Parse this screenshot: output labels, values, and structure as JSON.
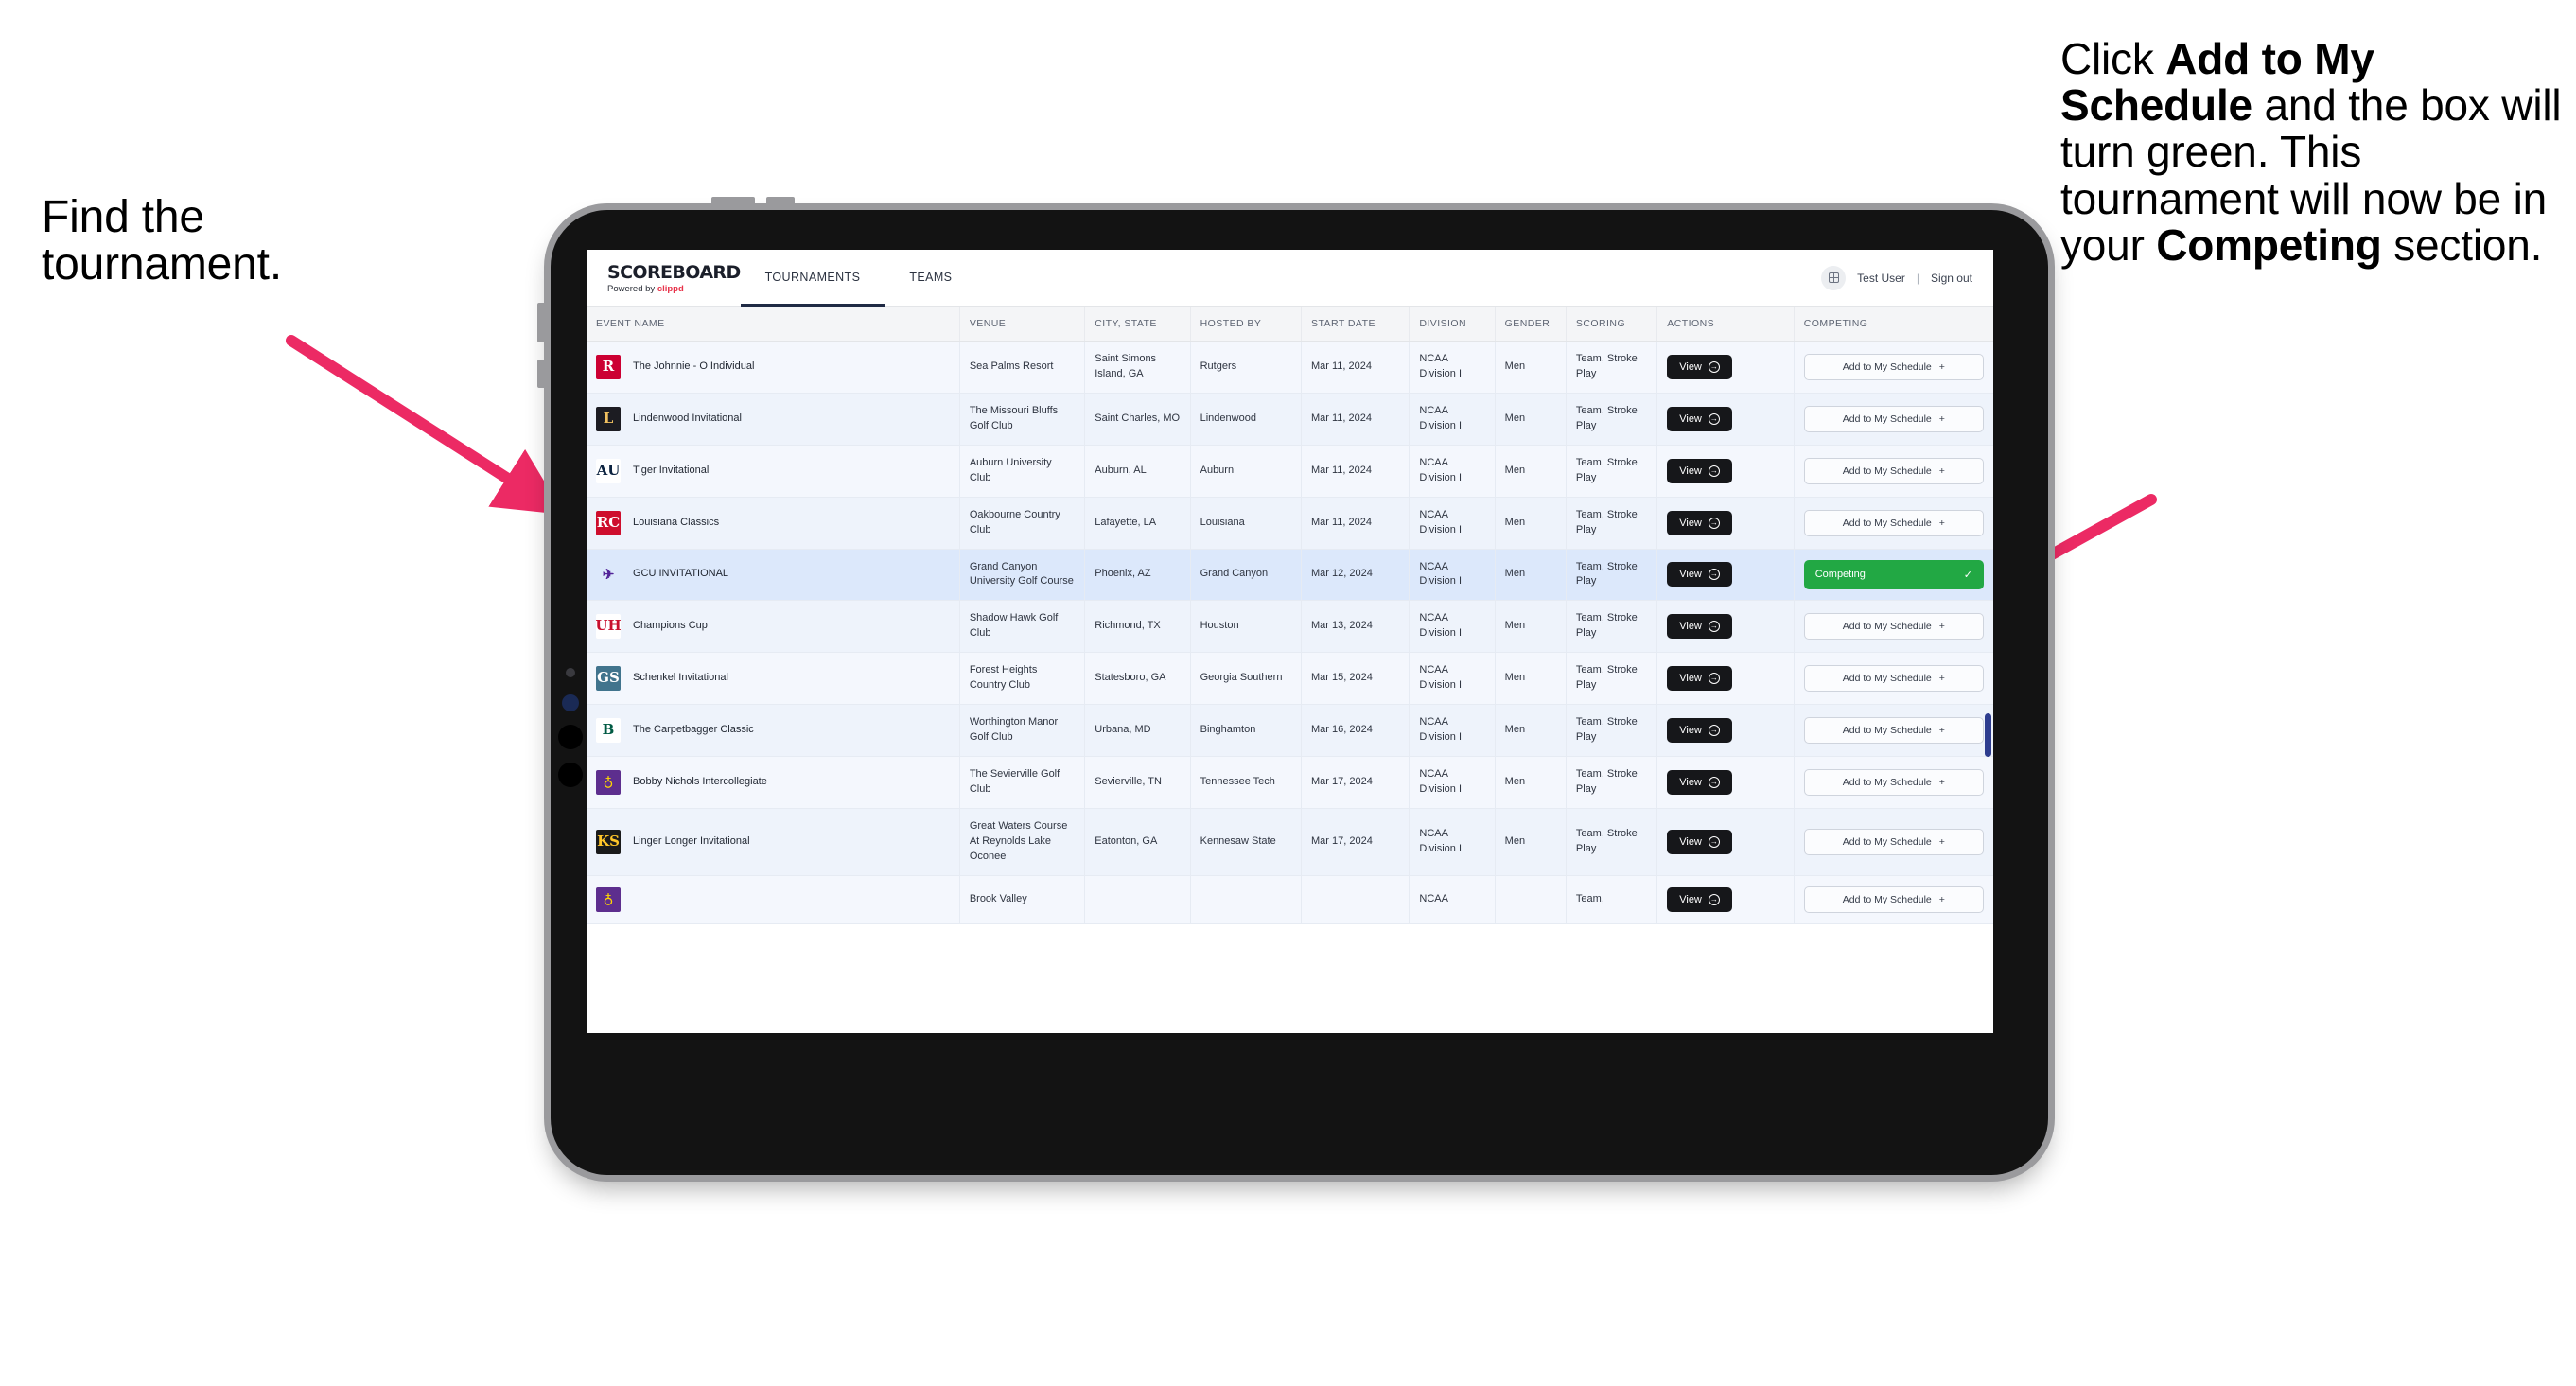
{
  "annotations": {
    "left": "Find the tournament.",
    "right_parts": [
      {
        "text": "Click ",
        "bold": false
      },
      {
        "text": "Add to My Schedule",
        "bold": true
      },
      {
        "text": " and the box will turn green. This tournament will now be in your ",
        "bold": false
      },
      {
        "text": "Competing",
        "bold": true
      },
      {
        "text": " section.",
        "bold": false
      }
    ],
    "arrow_color": "#ec2a64"
  },
  "app": {
    "brand_title": "SCOREBOARD",
    "brand_sub_prefix": "Powered by ",
    "brand_sub_name": "clippd",
    "tabs": [
      {
        "label": "TOURNAMENTS",
        "active": true
      },
      {
        "label": "TEAMS",
        "active": false
      }
    ],
    "header_right": {
      "app_icon": "grid-icon",
      "user": "Test User",
      "separator": "|",
      "signout": "Sign out"
    },
    "accent_green": "#22a844",
    "accent_pink": "#e8334a"
  },
  "table": {
    "columns": [
      "EVENT NAME",
      "VENUE",
      "CITY, STATE",
      "HOSTED BY",
      "START DATE",
      "DIVISION",
      "GENDER",
      "SCORING",
      "ACTIONS",
      "COMPETING"
    ],
    "view_label": "View",
    "add_label": "Add to My Schedule",
    "competing_label": "Competing",
    "rows": [
      {
        "event": "The Johnnie - O Individual",
        "logo": {
          "text": "R",
          "color": "#ffffff",
          "bg": "#cc0033"
        },
        "venue": "Sea Palms Resort",
        "city": "Saint Simons Island, GA",
        "hosted_by": "Rutgers",
        "start_date": "Mar 11, 2024",
        "division": "NCAA Division I",
        "gender": "Men",
        "scoring": "Team, Stroke Play",
        "competing": false
      },
      {
        "event": "Lindenwood Invitational",
        "logo": {
          "text": "L",
          "color": "#f0c060",
          "bg": "#1c1c22"
        },
        "venue": "The Missouri Bluffs Golf Club",
        "city": "Saint Charles, MO",
        "hosted_by": "Lindenwood",
        "start_date": "Mar 11, 2024",
        "division": "NCAA Division I",
        "gender": "Men",
        "scoring": "Team, Stroke Play",
        "competing": false
      },
      {
        "event": "Tiger Invitational",
        "logo": {
          "text": "AU",
          "color": "#0c2340",
          "bg": "#ffffff"
        },
        "venue": "Auburn University Club",
        "city": "Auburn, AL",
        "hosted_by": "Auburn",
        "start_date": "Mar 11, 2024",
        "division": "NCAA Division I",
        "gender": "Men",
        "scoring": "Team, Stroke Play",
        "competing": false
      },
      {
        "event": "Louisiana Classics",
        "logo": {
          "text": "RC",
          "color": "#ffffff",
          "bg": "#ce0e2d"
        },
        "venue": "Oakbourne Country Club",
        "city": "Lafayette, LA",
        "hosted_by": "Louisiana",
        "start_date": "Mar 11, 2024",
        "division": "NCAA Division I",
        "gender": "Men",
        "scoring": "Team, Stroke Play",
        "competing": false
      },
      {
        "event": "GCU INVITATIONAL",
        "logo": {
          "text": "✈",
          "color": "#522398",
          "bg": "transparent"
        },
        "venue": "Grand Canyon University Golf Course",
        "city": "Phoenix, AZ",
        "hosted_by": "Grand Canyon",
        "start_date": "Mar 12, 2024",
        "division": "NCAA Division I",
        "gender": "Men",
        "scoring": "Team, Stroke Play",
        "competing": true
      },
      {
        "event": "Champions Cup",
        "logo": {
          "text": "UH",
          "color": "#c8102e",
          "bg": "#ffffff"
        },
        "venue": "Shadow Hawk Golf Club",
        "city": "Richmond, TX",
        "hosted_by": "Houston",
        "start_date": "Mar 13, 2024",
        "division": "NCAA Division I",
        "gender": "Men",
        "scoring": "Team, Stroke Play",
        "competing": false
      },
      {
        "event": "Schenkel Invitational",
        "logo": {
          "text": "GS",
          "color": "#ffffff",
          "bg": "#41748d"
        },
        "venue": "Forest Heights Country Club",
        "city": "Statesboro, GA",
        "hosted_by": "Georgia Southern",
        "start_date": "Mar 15, 2024",
        "division": "NCAA Division I",
        "gender": "Men",
        "scoring": "Team, Stroke Play",
        "competing": false
      },
      {
        "event": "The Carpetbagger Classic",
        "logo": {
          "text": "B",
          "color": "#005a43",
          "bg": "#ffffff"
        },
        "venue": "Worthington Manor Golf Club",
        "city": "Urbana, MD",
        "hosted_by": "Binghamton",
        "start_date": "Mar 16, 2024",
        "division": "NCAA Division I",
        "gender": "Men",
        "scoring": "Team, Stroke Play",
        "competing": false
      },
      {
        "event": "Bobby Nichols Intercollegiate",
        "logo": {
          "text": "♁",
          "color": "#ffd700",
          "bg": "#5d2e8e"
        },
        "venue": "The Sevierville Golf Club",
        "city": "Sevierville, TN",
        "hosted_by": "Tennessee Tech",
        "start_date": "Mar 17, 2024",
        "division": "NCAA Division I",
        "gender": "Men",
        "scoring": "Team, Stroke Play",
        "competing": false
      },
      {
        "event": "Linger Longer Invitational",
        "logo": {
          "text": "KS",
          "color": "#ffc629",
          "bg": "#1a1a1a"
        },
        "venue": "Great Waters Course At Reynolds Lake Oconee",
        "city": "Eatonton, GA",
        "hosted_by": "Kennesaw State",
        "start_date": "Mar 17, 2024",
        "division": "NCAA Division I",
        "gender": "Men",
        "scoring": "Team, Stroke Play",
        "competing": false
      },
      {
        "event": "",
        "logo": {
          "text": "♁",
          "color": "#ffd700",
          "bg": "#5d2e8e"
        },
        "venue": "Brook Valley",
        "city": "",
        "hosted_by": "",
        "start_date": "",
        "division": "NCAA",
        "gender": "",
        "scoring": "Team,",
        "competing": false,
        "partial": true
      }
    ]
  }
}
